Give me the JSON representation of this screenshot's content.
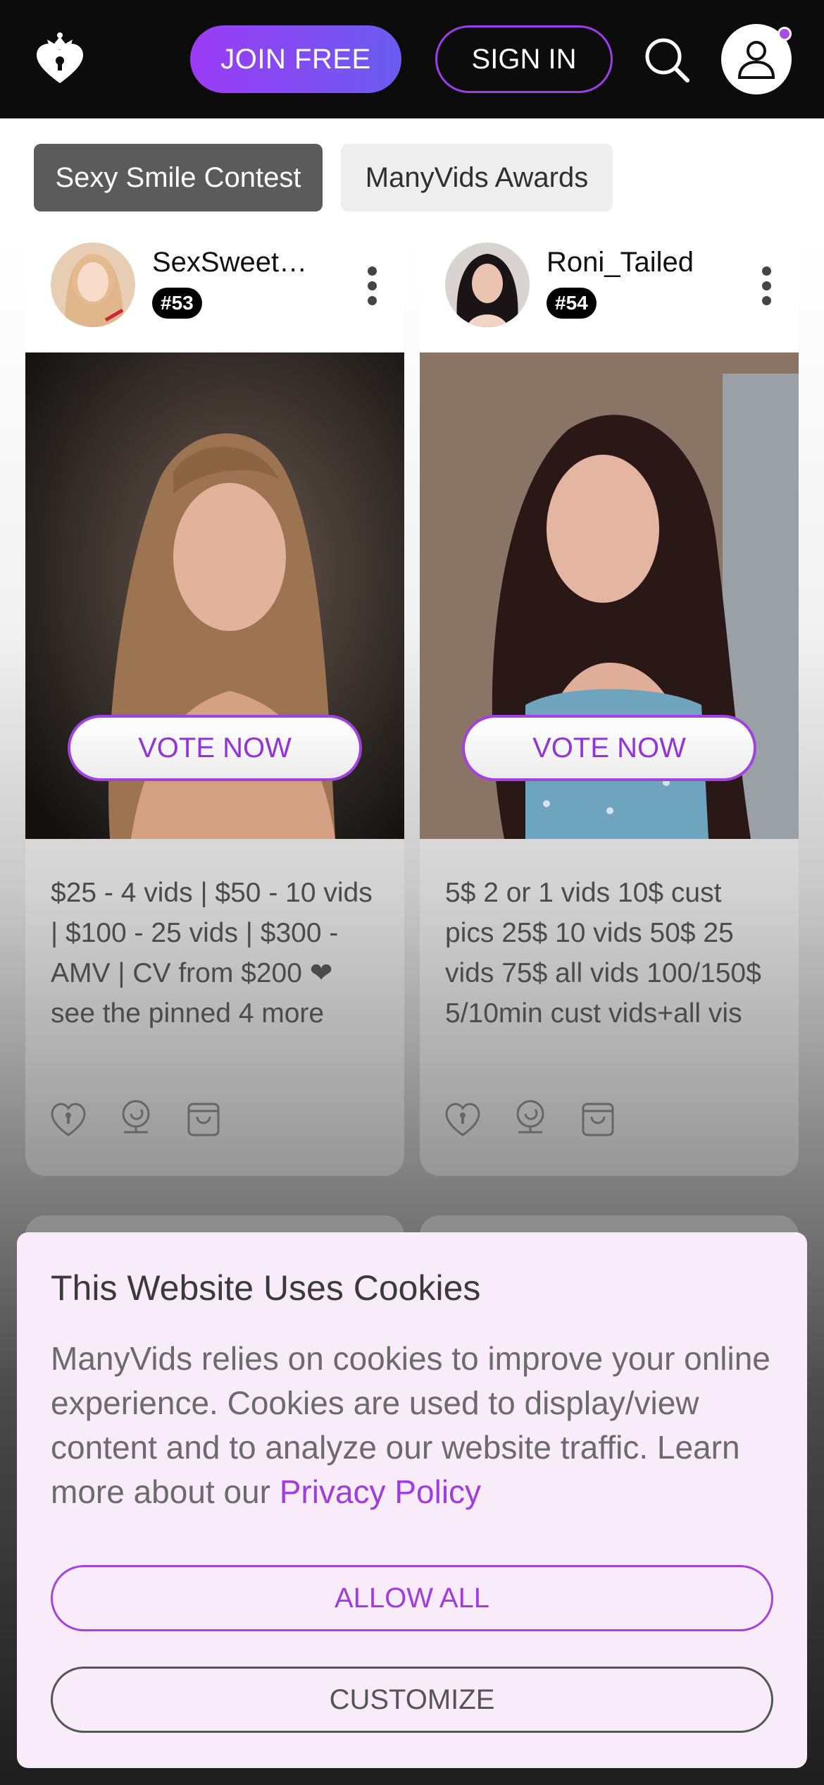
{
  "header": {
    "join_label": "JOIN FREE",
    "signin_label": "SIGN IN",
    "logo_icon": "crown-heart-logo",
    "search_icon": "search-icon",
    "user_icon": "user-icon",
    "accent": "#9b3cf6"
  },
  "tabs": [
    {
      "label": "Sexy Smile Contest",
      "active": true
    },
    {
      "label": "ManyVids Awards",
      "active": false
    }
  ],
  "cards": [
    {
      "name": "SexSweet…",
      "rank": "#53",
      "vote_label": "VOTE NOW",
      "description": "$25 - 4 vids | $50 - 10 vids | $100 - 25 vids | $300 - AMV | CV from $200 ❤ see the pinned 4 more",
      "icons": [
        "lock-heart-icon",
        "webcam-icon",
        "store-bag-icon"
      ]
    },
    {
      "name": "Roni_Tailed",
      "rank": "#54",
      "vote_label": "VOTE NOW",
      "description": "5$ 2 or 1 vids 10$ cust pics 25$ 10 vids 50$ 25 vids 75$ all vids 100/150$ 5/10min cust vids+all vis",
      "icons": [
        "lock-heart-icon",
        "webcam-icon",
        "store-bag-icon"
      ]
    }
  ],
  "cookie": {
    "title": "This Website Uses Cookies",
    "text": "ManyVids relies on cookies to improve your online experience. Cookies are used to display/view content and to analyze our website traffic. Learn more about our ",
    "link": "Privacy Policy",
    "allow_label": "ALLOW ALL",
    "customize_label": "CUSTOMIZE"
  }
}
